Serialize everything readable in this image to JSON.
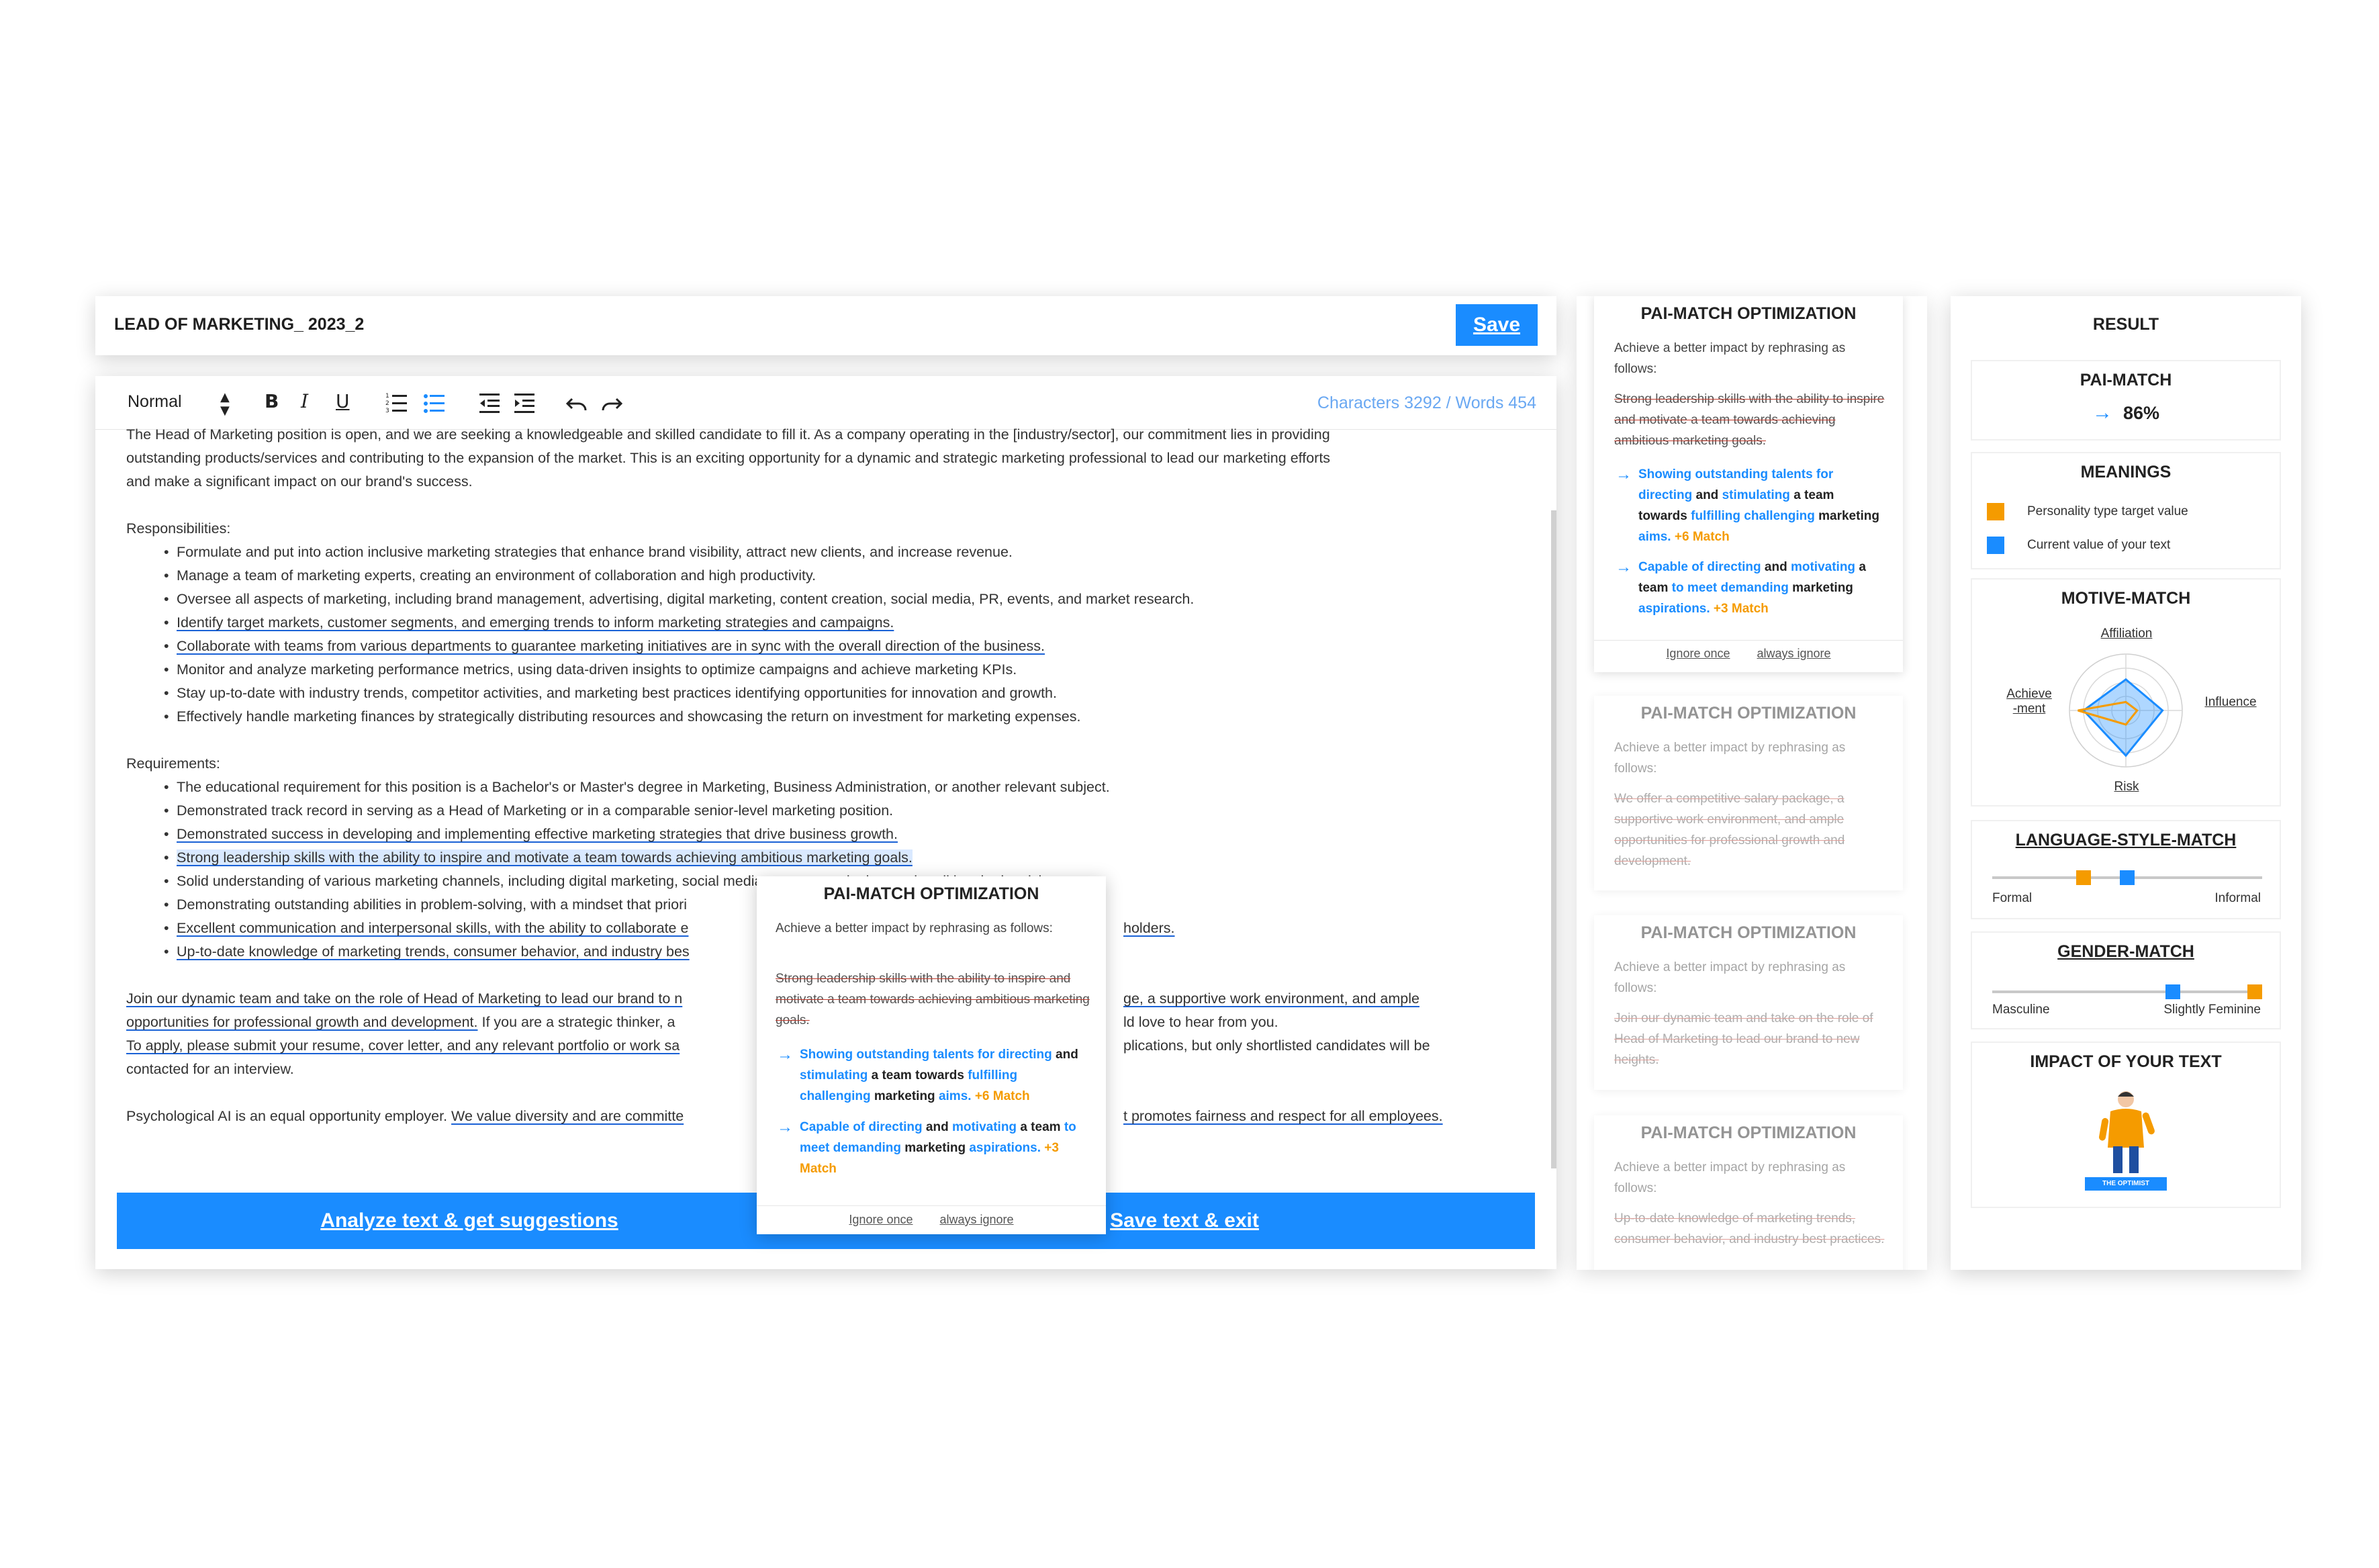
{
  "document": {
    "title": "LEAD OF MARKETING_ 2023_2",
    "save_label": "Save"
  },
  "toolbar": {
    "style_select": "Normal",
    "counts": "Characters 3292 / Words 454"
  },
  "editor": {
    "intro_line_1": "The Head of Marketing position is open, and we are seeking a knowledgeable and skilled candidate to fill it. As a company operating in the [industry/sector], our commitment lies in providing",
    "intro_line_2": "outstanding products/services and contributing to the expansion of the market. This is an exciting opportunity for a dynamic and strategic marketing professional to lead our marketing efforts",
    "intro_line_3": "and make a significant impact on our brand's success.",
    "responsibilities_heading": "Responsibilities:",
    "responsibilities": [
      "Formulate and put into action inclusive marketing strategies that enhance brand visibility, attract new clients, and increase revenue.",
      "Manage a team of marketing experts, creating an environment of collaboration and high productivity.",
      "Oversee all aspects of marketing, including brand management, advertising, digital marketing, content creation, social media, PR, events, and market research.",
      "Identify target markets, customer segments, and emerging trends to inform marketing strategies and campaigns.",
      "Collaborate with teams from various departments to guarantee marketing initiatives are in sync with the overall direction of the business.",
      "Monitor and analyze marketing performance metrics, using data-driven insights to optimize campaigns and achieve marketing KPIs.",
      "Stay up-to-date with industry trends, competitor activities, and marketing best practices identifying opportunities for innovation and growth.",
      "Effectively handle marketing finances by strategically distributing resources and showcasing the return on investment for marketing expenses."
    ],
    "requirements_heading": "Requirements:",
    "requirements": [
      "The educational requirement for this position is a Bachelor's or Master's degree in Marketing, Business Administration, or another relevant subject.",
      "Demonstrated track record in serving as a Head of Marketing or in a comparable senior-level marketing position.",
      "Demonstrated success in developing and implementing effective marketing strategies that drive business growth.",
      "Strong leadership skills with the ability to inspire and motivate a team towards achieving ambitious marketing goals.",
      "Solid understanding of various marketing channels, including digital marketing, social media, content marketing, and traditional advertising.",
      "Demonstrating outstanding abilities in problem-solving, with a mindset that priori",
      "Excellent communication and interpersonal skills, with the ability to collaborate e",
      "Up-to-date knowledge of marketing trends, consumer behavior, and industry bes"
    ],
    "req_tail_7": "holders.",
    "closing_1a": "Join our dynamic team and take on the role of Head of Marketing to lead our brand to n",
    "closing_1b": "ge, a supportive work environment, and ample",
    "closing_2a": "opportunities for professional growth and development.",
    "closing_2b": " If you are a strategic thinker, a",
    "closing_2c": "ld love to hear from you.",
    "closing_3a": "To apply, please submit your resume, cover letter, and any relevant portfolio or work sa",
    "closing_3b": "plications, but only shortlisted candidates will be",
    "closing_4": "contacted for an interview.",
    "eeo_a": "Psychological AI is an equal opportunity employer. ",
    "eeo_b": "We value diversity and are committe",
    "eeo_c": "t promotes fairness and respect for all employees.",
    "analyze_label": "Analyze text & get suggestions",
    "exit_label": "Save text & exit"
  },
  "popup": {
    "title": "PAI-MATCH OPTIMIZATION",
    "subtitle": "Achieve a better impact by rephrasing as follows:",
    "original": "Strong leadership skills with the ability to inspire and motivate a team towards achieving ambitious marketing goals.",
    "s1_a": "Showing outstanding talents for directing",
    "s1_b": " and ",
    "s1_c": "stimulating",
    "s1_d": " a team towards ",
    "s1_e": "fulfilling challenging",
    "s1_f": " marketing ",
    "s1_g": "aims.",
    "s1_match": " +6 Match",
    "s2_a": "Capable of directing",
    "s2_b": " and ",
    "s2_c": "motivating",
    "s2_d": " a team ",
    "s2_e": "to meet demanding",
    "s2_f": " marketing ",
    "s2_g": "aspirations.",
    "s2_match": " +3 Match",
    "ignore_once": "Ignore once",
    "always_ignore": "always ignore"
  },
  "suggestions": {
    "active": {
      "title": "PAI-MATCH OPTIMIZATION",
      "subtitle": "Achieve a better impact by rephrasing as follows:",
      "original": "Strong leadership skills with the ability to inspire and motivate a team towards achieving ambitious marketing goals.",
      "s1_a": "Showing outstanding talents for directing",
      "s1_b": " and ",
      "s1_c": "stimulating",
      "s1_d": " a team towards ",
      "s1_e": "fulfilling challenging",
      "s1_f": " marketing ",
      "s1_g": "aims.",
      "s1_match": " +6 Match",
      "s2_a": "Capable of directing",
      "s2_b": " and ",
      "s2_c": "motivating",
      "s2_d": " a team ",
      "s2_e": "to meet demanding",
      "s2_f": " marketing ",
      "s2_g": "aspirations.",
      "s2_match": " +3 Match",
      "ignore_once": "Ignore once",
      "always_ignore": "always ignore"
    },
    "inactive": [
      {
        "title": "PAI-MATCH OPTIMIZATION",
        "subtitle": "Achieve a better impact by rephrasing as follows:",
        "original": "We offer a competitive salary package, a supportive work environment, and ample opportunities for professional growth and development."
      },
      {
        "title": "PAI-MATCH OPTIMIZATION",
        "subtitle": "Achieve a better impact by rephrasing as follows:",
        "original": "Join our dynamic team and take on the role of Head of Marketing to lead our brand to new heights."
      },
      {
        "title": "PAI-MATCH OPTIMIZATION",
        "subtitle": "Achieve a better impact by rephrasing as follows:",
        "original": "Up-to-date knowledge of marketing trends, consumer behavior, and industry best practices."
      }
    ]
  },
  "result": {
    "title": "RESULT",
    "pai_match_title": "PAI-MATCH",
    "pai_match_value": "86%",
    "meanings_title": "MEANINGS",
    "meaning_target": "Personality type target value",
    "meaning_current": "Current value of your text",
    "motive_title": "MOTIVE-MATCH",
    "motive_affiliation": "Affiliation",
    "motive_achievement_1": "Achieve",
    "motive_achievement_2": "-ment",
    "motive_influence": "Influence",
    "motive_risk": "Risk",
    "motive_target": {
      "affiliation": 0.15,
      "influence": 0.2,
      "risk": 0.25,
      "achievement": 0.85
    },
    "motive_current": {
      "affiliation": 0.55,
      "influence": 0.65,
      "risk": 0.8,
      "achievement": 0.75
    },
    "lsm_title": "LANGUAGE-STYLE-MATCH",
    "lsm_left": "Formal",
    "lsm_right": "Informal",
    "lsm_target": 0.33,
    "lsm_current": 0.5,
    "gender_title": "GENDER-MATCH",
    "gender_left": "Masculine",
    "gender_right": "Slightly Feminine",
    "gender_target": 1.0,
    "gender_current": 0.68,
    "impact_title": "IMPACT OF YOUR TEXT",
    "impact_badge": "THE OPTIMIST"
  },
  "colors": {
    "accent": "#1a8cff",
    "target": "#f59b00",
    "strike": "#c0392b"
  }
}
